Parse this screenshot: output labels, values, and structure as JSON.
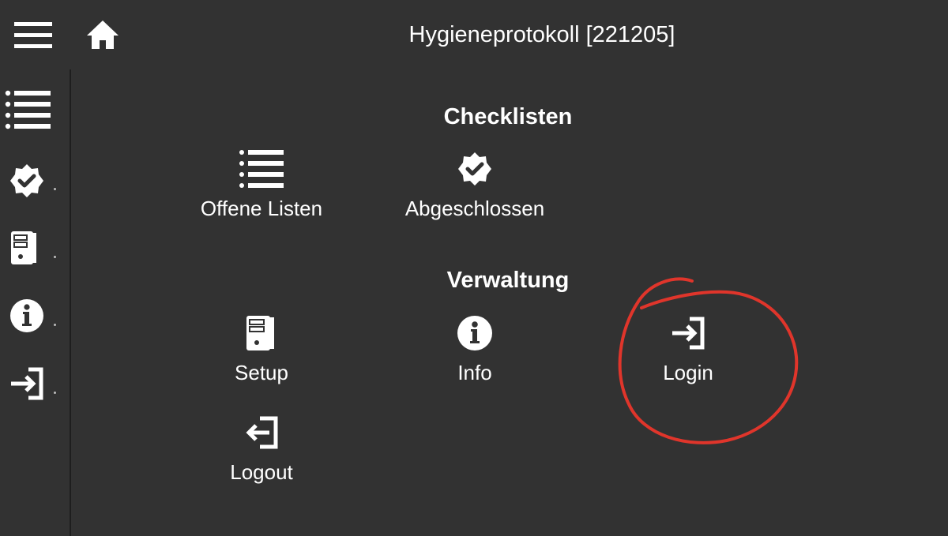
{
  "header": {
    "title": "Hygieneprotokoll [221205]",
    "menu_icon": "hamburger-menu-icon",
    "home_icon": "home-icon"
  },
  "sidebar": {
    "items": [
      {
        "name": "open-lists",
        "icon": "list-icon"
      },
      {
        "name": "completed",
        "icon": "check-badge-icon"
      },
      {
        "name": "setup",
        "icon": "computer-tower-icon"
      },
      {
        "name": "info",
        "icon": "info-icon"
      },
      {
        "name": "login",
        "icon": "login-icon"
      }
    ]
  },
  "main": {
    "checklists": {
      "title": "Checklisten",
      "items": [
        {
          "label": "Offene Listen",
          "icon": "list-icon"
        },
        {
          "label": "Abgeschlossen",
          "icon": "check-badge-icon"
        }
      ]
    },
    "administration": {
      "title": "Verwaltung",
      "items": [
        {
          "label": "Setup",
          "icon": "computer-tower-icon"
        },
        {
          "label": "Info",
          "icon": "info-icon"
        },
        {
          "label": "Login",
          "icon": "login-icon"
        },
        {
          "label": "Logout",
          "icon": "logout-icon"
        }
      ]
    }
  },
  "colors": {
    "background": "#323232",
    "foreground": "#ffffff",
    "annotation": "#e0352b"
  }
}
